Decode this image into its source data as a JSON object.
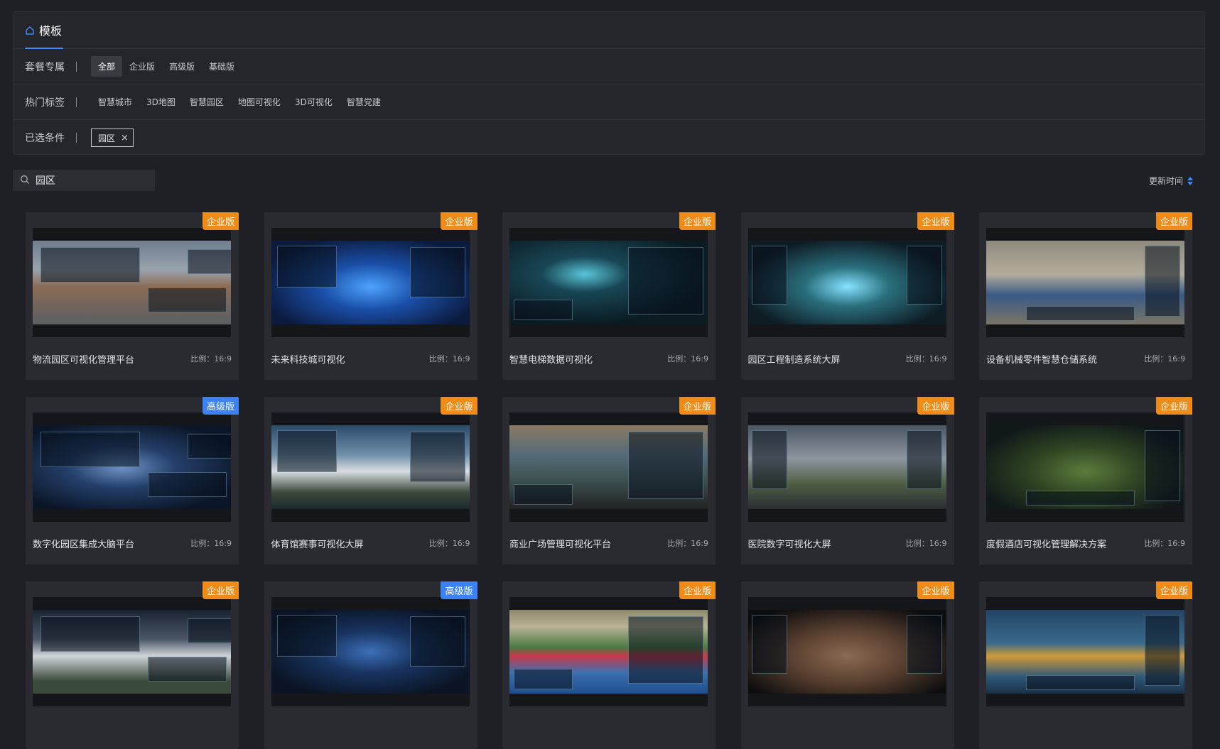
{
  "panel": {
    "tab_label": "模板",
    "package_label": "套餐专属",
    "package_options": [
      "全部",
      "企业版",
      "高级版",
      "基础版"
    ],
    "hot_tags_label": "热门标签",
    "hot_tags": [
      "智慧城市",
      "3D地图",
      "智慧园区",
      "地图可视化",
      "3D可视化",
      "智慧党建"
    ],
    "selected_label": "已选条件",
    "selected_chip": "园区"
  },
  "search": {
    "value": "园区"
  },
  "sort": {
    "label": "更新时间"
  },
  "colors": {
    "accent": "#3d8bff",
    "enterprise_badge": "#f08b18",
    "advanced_badge": "#3b82f6"
  },
  "cards": [
    {
      "title": "物流园区可视化管理平台",
      "ratio": "比例：16:9",
      "badge": "企业版",
      "badge_type": "ent",
      "scene": "s-logistics"
    },
    {
      "title": "未来科技城可视化",
      "ratio": "比例：16:9",
      "badge": "企业版",
      "badge_type": "ent",
      "scene": "s-tech"
    },
    {
      "title": "智慧电梯数据可视化",
      "ratio": "比例：16:9",
      "badge": "企业版",
      "badge_type": "ent",
      "scene": "s-elevator"
    },
    {
      "title": "园区工程制造系统大屏",
      "ratio": "比例：16:9",
      "badge": "企业版",
      "badge_type": "ent",
      "scene": "s-factory"
    },
    {
      "title": "设备机械零件智慧仓储系统",
      "ratio": "比例：16:9",
      "badge": "企业版",
      "badge_type": "ent",
      "scene": "s-warehouse"
    },
    {
      "title": "数字化园区集成大脑平台",
      "ratio": "比例：16:9",
      "badge": "高级版",
      "badge_type": "adv",
      "scene": "s-digital"
    },
    {
      "title": "体育馆赛事可视化大屏",
      "ratio": "比例：16:9",
      "badge": "企业版",
      "badge_type": "ent",
      "scene": "s-stadium"
    },
    {
      "title": "商业广场管理可视化平台",
      "ratio": "比例：16:9",
      "badge": "企业版",
      "badge_type": "ent",
      "scene": "s-plaza"
    },
    {
      "title": "医院数字可视化大屏",
      "ratio": "比例：16:9",
      "badge": "企业版",
      "badge_type": "ent",
      "scene": "s-hospital"
    },
    {
      "title": "度假酒店可视化管理解决方案",
      "ratio": "比例：16:9",
      "badge": "企业版",
      "badge_type": "ent",
      "scene": "s-resort"
    },
    {
      "title": "",
      "ratio": "",
      "badge": "企业版",
      "badge_type": "ent",
      "scene": "s-office"
    },
    {
      "title": "",
      "ratio": "",
      "badge": "高级版",
      "badge_type": "adv",
      "scene": "s-gov"
    },
    {
      "title": "",
      "ratio": "",
      "badge": "企业版",
      "badge_type": "ent",
      "scene": "s-sport"
    },
    {
      "title": "",
      "ratio": "",
      "badge": "企业版",
      "badge_type": "ent",
      "scene": "s-ancient"
    },
    {
      "title": "",
      "ratio": "",
      "badge": "企业版",
      "badge_type": "ent",
      "scene": "s-port"
    }
  ]
}
